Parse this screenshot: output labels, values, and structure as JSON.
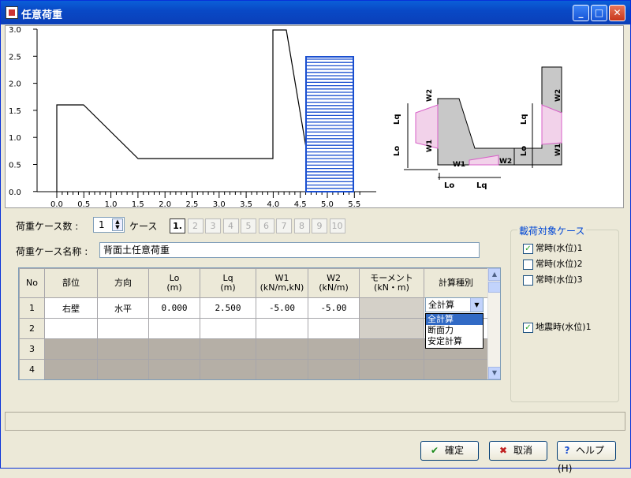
{
  "window": {
    "title": "任意荷重"
  },
  "graph": {
    "y_ticks": [
      "3.0",
      "2.5",
      "2.0",
      "1.5",
      "1.0",
      "0.5",
      "0.0"
    ],
    "x_ticks": [
      "0.0",
      "0.5",
      "1.0",
      "1.5",
      "2.0",
      "2.5",
      "3.0",
      "3.5",
      "4.0",
      "4.5",
      "5.0",
      "5.5"
    ]
  },
  "diagram": {
    "lq": "Lq",
    "lo": "Lo",
    "w1": "W1",
    "w2": "W2"
  },
  "case_count": {
    "label": "荷重ケース数 :",
    "value": "1",
    "suffix": "ケース"
  },
  "case_buttons": [
    "1.",
    "2",
    "3",
    "4",
    "5",
    "6",
    "7",
    "8",
    "9",
    "10"
  ],
  "case_name": {
    "label": "荷重ケース名称 :",
    "value": "背面土任意荷重"
  },
  "table": {
    "headers": [
      "No",
      "部位",
      "方向",
      "Lo\n(m)",
      "Lq\n(m)",
      "W1\n(kN/m,kN)",
      "W2\n(kN/m)",
      "モーメント\n(kN・m)",
      "計算種別"
    ],
    "rows": [
      {
        "no": "1",
        "part": "右壁",
        "dir": "水平",
        "lo": "0.000",
        "lq": "2.500",
        "w1": "-5.00",
        "w2": "-5.00",
        "moment": "",
        "calc": "全計算"
      },
      {
        "no": "2",
        "part": "",
        "dir": "",
        "lo": "",
        "lq": "",
        "w1": "",
        "w2": "",
        "moment": "",
        "calc": ""
      },
      {
        "no": "3"
      },
      {
        "no": "4"
      }
    ],
    "dropdown_options": [
      "全計算",
      "断面力",
      "安定計算"
    ],
    "dropdown_selected": "全計算"
  },
  "case_group": {
    "title": "載荷対象ケース",
    "items": [
      {
        "label": "常時(水位)1",
        "checked": true
      },
      {
        "label": "常時(水位)2",
        "checked": false
      },
      {
        "label": "常時(水位)3",
        "checked": false
      },
      {
        "label": "地震時(水位)1",
        "checked": true
      }
    ]
  },
  "buttons": {
    "ok": "確定",
    "cancel": "取消",
    "help": "ヘルプ(H)"
  },
  "colors": {
    "title_bar": "#0a4fc8",
    "load_fill": "#1a4fd0",
    "load_pink": "#d860c8"
  }
}
